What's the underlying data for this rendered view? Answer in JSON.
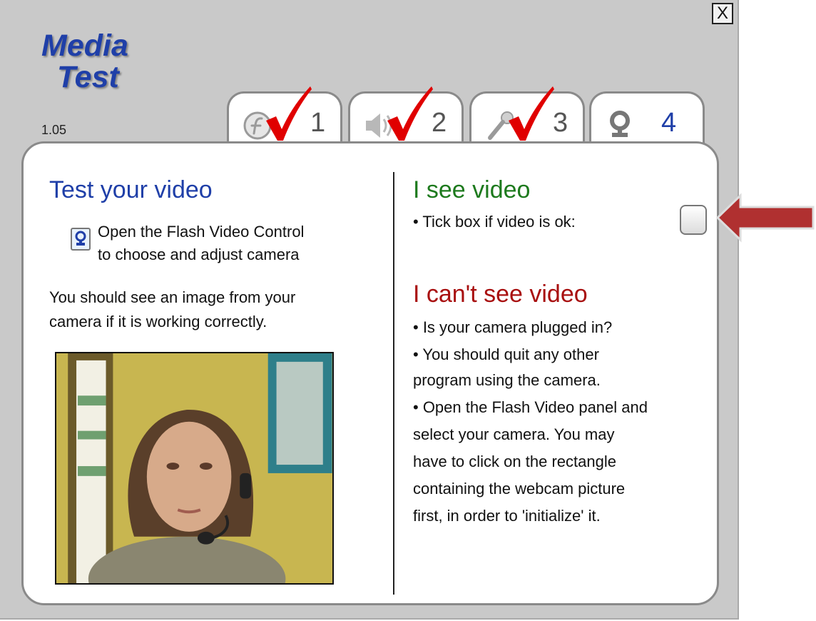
{
  "window": {
    "close_label": "X",
    "logo_line1": "Media",
    "logo_line2": "Test",
    "version": "1.05"
  },
  "tabs": [
    {
      "icon": "flash-icon",
      "number": "1",
      "checked": true
    },
    {
      "icon": "speaker-icon",
      "number": "2",
      "checked": true
    },
    {
      "icon": "microphone-icon",
      "number": "3",
      "checked": true
    },
    {
      "icon": "webcam-icon",
      "number": "4",
      "checked": false,
      "active": true
    }
  ],
  "left": {
    "title": "Test your video",
    "flash_line1": "Open the Flash Video Control",
    "flash_line2": "to choose and adjust camera",
    "info_line1": "You should see an image from your",
    "info_line2": "camera if it is working correctly."
  },
  "right": {
    "see_title": "I see video",
    "tick_label": "• Tick box if video is ok:",
    "cant_title": "I can't see video",
    "lines": [
      "• Is your camera plugged in?",
      "• You should quit any other",
      "program using the camera.",
      "• Open the Flash Video panel and",
      "select your camera. You may",
      "have to click on the rectangle",
      "containing the webcam picture",
      "first, in order to 'initialize' it."
    ]
  },
  "colors": {
    "accent_blue": "#1f3fa8",
    "ok_green": "#1d7a1d",
    "error_red": "#a80f0f",
    "check_red": "#e00000",
    "arrow_red": "#b03030"
  }
}
